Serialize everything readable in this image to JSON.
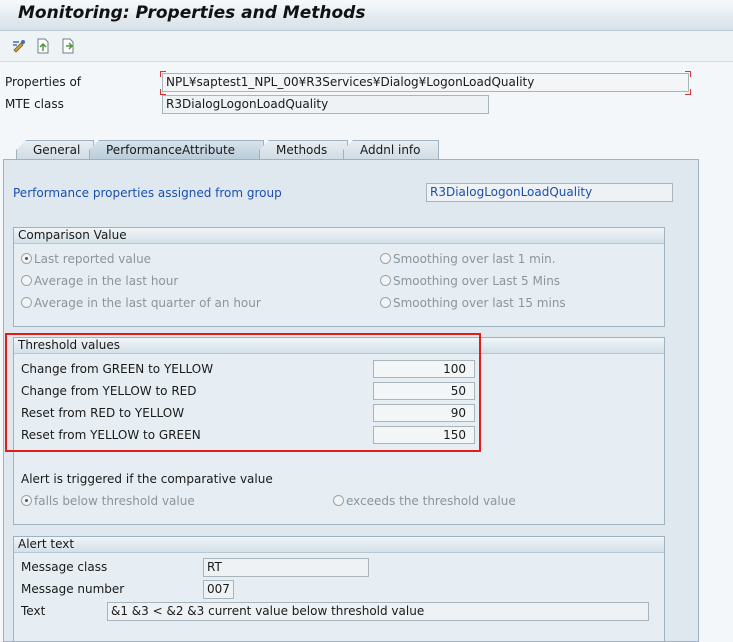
{
  "window": {
    "title": "Monitoring: Properties and Methods"
  },
  "toolbar": {
    "icons": [
      "display-change-icon",
      "new-document-icon",
      "copy-document-icon"
    ]
  },
  "header": {
    "properties_of_label": "Properties of",
    "properties_of_value": "NPL¥saptest1_NPL_00¥R3Services¥Dialog¥LogonLoadQuality",
    "mte_class_label": "MTE class",
    "mte_class_value": "R3DialogLogonLoadQuality"
  },
  "tabs": [
    {
      "label": "General"
    },
    {
      "label": "PerformanceAttribute"
    },
    {
      "label": "Methods"
    },
    {
      "label": "Addnl info"
    }
  ],
  "assigned": {
    "label": "Performance properties assigned from group",
    "value": "R3DialogLogonLoadQuality"
  },
  "comparison": {
    "title": "Comparison Value",
    "options": [
      "Last reported value",
      "Average in the last hour",
      "Average in the last quarter of an hour",
      "Smoothing over last 1 min.",
      "Smoothing over Last 5 Mins",
      "Smoothing over last 15 mins"
    ]
  },
  "thresholds": {
    "title": "Threshold values",
    "rows": [
      {
        "label": "Change from GREEN to YELLOW",
        "value": "100"
      },
      {
        "label": "Change from YELLOW to RED",
        "value": "50"
      },
      {
        "label": "Reset from RED to YELLOW",
        "value": "90"
      },
      {
        "label": "Reset from YELLOW to GREEN",
        "value": "150"
      }
    ],
    "alert_trigger_label": "Alert is triggered if the comparative value",
    "below_option": "falls below threshold value",
    "exceeds_option": "exceeds the threshold value"
  },
  "alert_text": {
    "title": "Alert text",
    "message_class_label": "Message class",
    "message_class_value": "RT",
    "message_number_label": "Message number",
    "message_number_value": "007",
    "text_label": "Text",
    "text_value": "&1 &3 < &2 &3  current value below threshold value"
  },
  "colors": {
    "highlight": "#e21c1c",
    "link_blue": "#1a4fb0"
  }
}
